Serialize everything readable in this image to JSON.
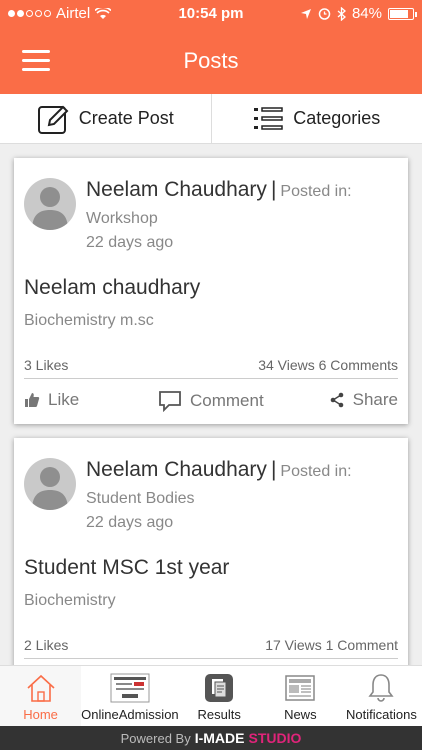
{
  "status_bar": {
    "carrier": "Airtel",
    "time": "10:54 pm",
    "battery": "84%",
    "battery_level": 0.84
  },
  "header": {
    "title": "Posts",
    "menu_icon": "hamburger-icon"
  },
  "actions": {
    "create_post": "Create Post",
    "categories": "Categories"
  },
  "posts": [
    {
      "author": "Neelam Chaudhary",
      "separator": "|",
      "posted_in_label": "Posted in:",
      "category": "Workshop",
      "time": "22 days ago",
      "title": "Neelam chaudhary",
      "subtitle": "Biochemistry m.sc",
      "likes": "3 Likes",
      "stats": "34 Views 6 Comments",
      "like_label": "Like",
      "comment_label": "Comment",
      "share_label": "Share"
    },
    {
      "author": "Neelam Chaudhary",
      "separator": "|",
      "posted_in_label": "Posted in:",
      "category": "Student Bodies",
      "time": "22 days ago",
      "title": "Student MSC 1st year",
      "subtitle": "Biochemistry",
      "likes": "2 Likes",
      "stats": "17 Views 1 Comment"
    }
  ],
  "bottom_nav": {
    "home": "Home",
    "online_admission": "OnlineAdmission",
    "results": "Results",
    "news": "News",
    "notifications": "Notifications"
  },
  "footer": {
    "powered_by": "Powered By",
    "brand": "I-MADE",
    "studio": "STUDIO"
  },
  "colors": {
    "accent": "#fa6d47",
    "footer_bg": "#333333",
    "studio": "#e0247a"
  }
}
